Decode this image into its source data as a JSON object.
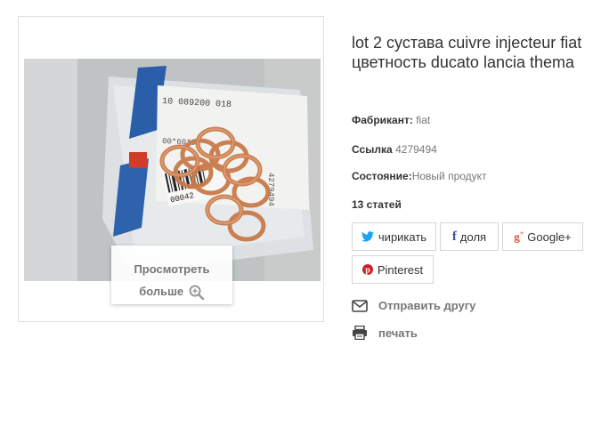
{
  "product": {
    "title": "lot 2 сустава cuivre injecteur fiat цветность ducato lancia thema",
    "manufacturer_label": "Фабрикант:",
    "manufacturer_value": "fiat",
    "reference_label": "Ссылка",
    "reference_value": "4279494",
    "condition_label": "Состояние:",
    "condition_value": "Новый продукт",
    "quantity_text": "13 статей"
  },
  "image": {
    "zoom_line1": "Просмотреть",
    "zoom_line2": "больше",
    "photo_label_code": "10 089200 018",
    "photo_barcode_text": "00042",
    "photo_part_number": "4279494"
  },
  "share": {
    "twitter_label": "чирикать",
    "facebook_label": "доля",
    "google_label": "Google+",
    "pinterest_label": "Pinterest"
  },
  "actions": {
    "send_friend_label": "Отправить другу",
    "print_label": "печать"
  },
  "colors": {
    "twitter": "#1da1f2",
    "facebook": "#3b5998",
    "google": "#dd4b39",
    "pinterest": "#cb2027"
  }
}
